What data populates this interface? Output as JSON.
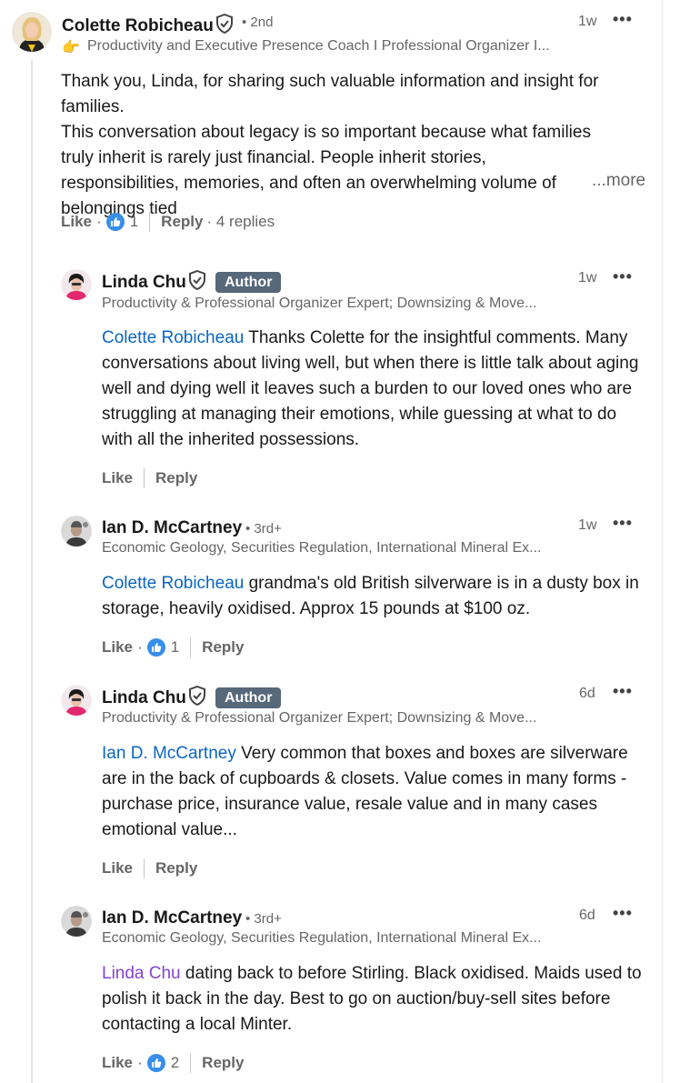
{
  "comments": [
    {
      "name": "Colette Robicheau",
      "degree": "• 2nd",
      "headline_emoji": "👉",
      "headline": "Productivity and Executive Presence Coach I Professional Organizer I...",
      "time": "1w",
      "body": [
        "Thank you, Linda, for sharing such valuable information and insight for families.",
        "This conversation about legacy is so important because what families truly inherit is rarely just financial. People inherit stories, responsibilities, memories, and often an overwhelming volume of belongings tied"
      ],
      "see_more": "...more",
      "like_label": "Like",
      "reactions": "1",
      "reply_label": "Reply",
      "replies": "· 4 replies"
    },
    {
      "name": "Linda Chu",
      "badge": "Author",
      "headline": "Productivity & Professional Organizer Expert; Downsizing & Move...",
      "time": "1w",
      "mention": "Colette Robicheau",
      "text": " Thanks Colette for the insightful comments. Many conversations about living well, but when there is little talk about aging well and dying well it leaves such a burden to our loved ones who are struggling at managing their emotions, while guessing at what to do with all the inherited possessions.",
      "like_label": "Like",
      "reply_label": "Reply"
    },
    {
      "name": "Ian D. McCartney",
      "degree": "• 3rd+",
      "headline": "Economic Geology, Securities Regulation, International Mineral Ex...",
      "time": "1w",
      "mention": "Colette Robicheau",
      "text": " grandma's old British silverware is in a dusty box in storage, heavily oxidised. Approx 15 pounds at $100 oz.",
      "like_label": "Like",
      "reactions": "1",
      "reply_label": "Reply"
    },
    {
      "name": "Linda Chu",
      "badge": "Author",
      "headline": "Productivity & Professional Organizer Expert; Downsizing & Move...",
      "time": "6d",
      "mention": "Ian D. McCartney",
      "text": " Very common that boxes and boxes are silverware are in the back of cupboards & closets. Value comes in many forms - purchase price, insurance value, resale value and in many cases emotional value...",
      "like_label": "Like",
      "reply_label": "Reply"
    },
    {
      "name": "Ian D. McCartney",
      "degree": "• 3rd+",
      "headline": "Economic Geology, Securities Regulation, International Mineral Ex...",
      "time": "6d",
      "mention": "Linda Chu",
      "text": " dating back to before Stirling. Black oxidised. Maids used to polish it back in the day. Best to go on auction/buy-sell sites before contacting a local Minter.",
      "like_label": "Like",
      "reactions": "2",
      "reply_label": "Reply"
    }
  ],
  "menu_icon": "ellipsis-icon",
  "verified_icon": "shield-check-icon",
  "reaction_icon": "thumbs-up-icon",
  "colors": {
    "link": "#0a66c2",
    "visited_link": "#8344cc",
    "author_badge": "#56687a"
  }
}
